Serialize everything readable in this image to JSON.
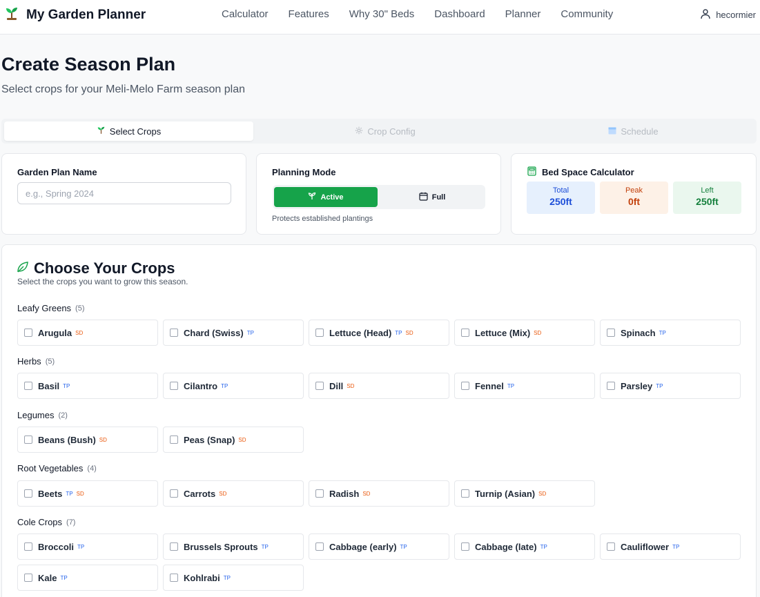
{
  "nav": {
    "brand": "My Garden Planner",
    "links": [
      "Calculator",
      "Features",
      "Why 30\" Beds",
      "Dashboard",
      "Planner",
      "Community"
    ],
    "username": "hecormier"
  },
  "header": {
    "title": "Create Season Plan",
    "subtitle": "Select crops for your Meli-Melo Farm season plan"
  },
  "steps": [
    "Select Crops",
    "Crop Config",
    "Schedule"
  ],
  "plan_name": {
    "label": "Garden Plan Name",
    "placeholder": "e.g., Spring 2024",
    "value": ""
  },
  "planning_mode": {
    "label": "Planning Mode",
    "options": [
      "Active",
      "Full"
    ],
    "selected": "Active",
    "hint": "Protects established plantings"
  },
  "bed_space": {
    "title": "Bed Space Calculator",
    "total_label": "Total",
    "total_value": "250ft",
    "peak_label": "Peak",
    "peak_value": "0ft",
    "left_label": "Left",
    "left_value": "250ft"
  },
  "crops": {
    "title": "Choose Your Crops",
    "subtitle": "Select the crops you want to grow this season.",
    "categories": [
      {
        "name": "Leafy Greens",
        "count": "(5)",
        "items": [
          {
            "name": "Arugula",
            "tags": [
              "SD"
            ]
          },
          {
            "name": "Chard (Swiss)",
            "tags": [
              "TP"
            ]
          },
          {
            "name": "Lettuce (Head)",
            "tags": [
              "TP",
              "SD"
            ]
          },
          {
            "name": "Lettuce (Mix)",
            "tags": [
              "SD"
            ]
          },
          {
            "name": "Spinach",
            "tags": [
              "TP"
            ]
          }
        ]
      },
      {
        "name": "Herbs",
        "count": "(5)",
        "items": [
          {
            "name": "Basil",
            "tags": [
              "TP"
            ]
          },
          {
            "name": "Cilantro",
            "tags": [
              "TP"
            ]
          },
          {
            "name": "Dill",
            "tags": [
              "SD"
            ]
          },
          {
            "name": "Fennel",
            "tags": [
              "TP"
            ]
          },
          {
            "name": "Parsley",
            "tags": [
              "TP"
            ]
          }
        ]
      },
      {
        "name": "Legumes",
        "count": "(2)",
        "items": [
          {
            "name": "Beans (Bush)",
            "tags": [
              "SD"
            ]
          },
          {
            "name": "Peas (Snap)",
            "tags": [
              "SD"
            ]
          }
        ]
      },
      {
        "name": "Root Vegetables",
        "count": "(4)",
        "items": [
          {
            "name": "Beets",
            "tags": [
              "TP",
              "SD"
            ]
          },
          {
            "name": "Carrots",
            "tags": [
              "SD"
            ]
          },
          {
            "name": "Radish",
            "tags": [
              "SD"
            ]
          },
          {
            "name": "Turnip (Asian)",
            "tags": [
              "SD"
            ]
          }
        ]
      },
      {
        "name": "Cole Crops",
        "count": "(7)",
        "items": [
          {
            "name": "Broccoli",
            "tags": [
              "TP"
            ]
          },
          {
            "name": "Brussels Sprouts",
            "tags": [
              "TP"
            ]
          },
          {
            "name": "Cabbage (early)",
            "tags": [
              "TP"
            ]
          },
          {
            "name": "Cabbage (late)",
            "tags": [
              "TP"
            ]
          },
          {
            "name": "Cauliflower",
            "tags": [
              "TP"
            ]
          },
          {
            "name": "Kale",
            "tags": [
              "TP"
            ]
          },
          {
            "name": "Kohlrabi",
            "tags": [
              "TP"
            ]
          }
        ]
      }
    ]
  },
  "colors": {
    "accent_green": "#16a34a",
    "tp_tag": "#2563eb",
    "sd_tag": "#ea580c"
  }
}
